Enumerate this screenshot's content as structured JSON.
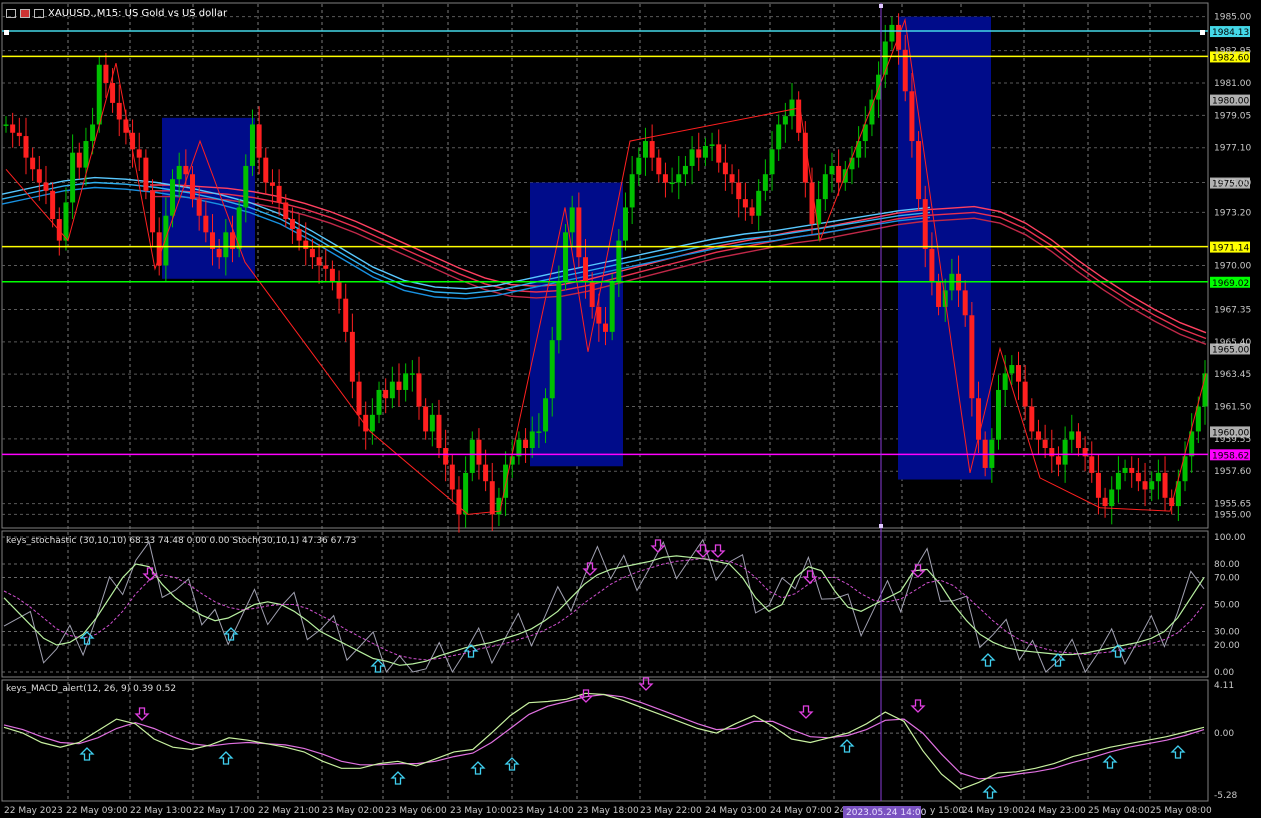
{
  "header": {
    "symbol_title": "XAUUSD.,M15: US Gold vs US dollar"
  },
  "price_axis": {
    "ticks": [
      "1985.00",
      "1982.95",
      "1981.00",
      "1979.05",
      "1977.10",
      "1975.00",
      "1973.20",
      "1970.00",
      "1967.35",
      "1965.40",
      "1963.45",
      "1961.50",
      "1959.55",
      "1957.60",
      "1955.65",
      "1955.00"
    ],
    "tick_values": [
      1985.0,
      1982.95,
      1981.0,
      1979.05,
      1977.1,
      1975.0,
      1973.2,
      1970.0,
      1967.35,
      1965.4,
      1963.45,
      1961.5,
      1959.55,
      1957.6,
      1955.65,
      1955.0
    ],
    "range": [
      1954.3,
      1985.7
    ]
  },
  "price_levels": [
    {
      "label": "1984.13",
      "value": 1984.13,
      "color": "#44d8e8"
    },
    {
      "label": "1982.60",
      "value": 1982.6,
      "color": "#ffff00"
    },
    {
      "label": "1980.00",
      "value": 1980.0,
      "color": "#b0b0b0"
    },
    {
      "label": "1975.00",
      "value": 1975.0,
      "color": "#b0b0b0"
    },
    {
      "label": "1971.14",
      "value": 1971.14,
      "color": "#ffff00"
    },
    {
      "label": "1969.02",
      "value": 1969.02,
      "color": "#00ff00"
    },
    {
      "label": "1965.00",
      "value": 1965.0,
      "color": "#b0b0b0"
    },
    {
      "label": "1960.00",
      "value": 1960.0,
      "color": "#b0b0b0"
    },
    {
      "label": "1958.62",
      "value": 1958.62,
      "color": "#ff00ff"
    }
  ],
  "stochastic": {
    "title": "keys_stochastic (30,10,10) 68.33 74.48 0.00 0.00 Stoch(30,10,1) 47.36 67.73",
    "ticks": [
      "100.00",
      "80.00",
      "70.00",
      "50.00",
      "30.00",
      "20.00",
      "0.00"
    ],
    "tick_values": [
      100,
      80,
      70,
      50,
      30,
      20,
      0
    ]
  },
  "macd": {
    "title": "keys_MACD_alert(12, 26, 9) 0.39 0.52",
    "ticks": [
      "4.11",
      "0.00",
      "-5.28"
    ],
    "tick_values": [
      4.11,
      0,
      -5.28
    ]
  },
  "time_axis": {
    "labels": [
      "22 May 2023",
      "22 May 09:00",
      "22 May 13:00",
      "22 May 17:00",
      "22 May 21:00",
      "23 May 02:00",
      "23 May 06:00",
      "23 May 10:00",
      "23 May 14:00",
      "23 May 18:00",
      "23 May 22:00",
      "24 May 03:00",
      "24 May 07:00",
      "24",
      "y 15:00",
      "24 May 19:00",
      "24 May 23:00",
      "25 May 04:00",
      "25 May 08:00"
    ],
    "cursor_label": "2023.05.24 14:00"
  },
  "chart_data": {
    "type": "candlestick",
    "symbol": "XAUUSD.",
    "timeframe": "M15",
    "bull_color": "#00c000",
    "bear_color": "#ff2020",
    "close_path": [
      1978.5,
      1978.0,
      1977.8,
      1976.5,
      1975.8,
      1975.0,
      1974.5,
      1972.8,
      1971.5,
      1973.8,
      1976.8,
      1975.9,
      1977.5,
      1978.5,
      1982.1,
      1981.0,
      1979.8,
      1978.8,
      1978.0,
      1977.0,
      1976.5,
      1974.5,
      1972.0,
      1970.0,
      1973.0,
      1975.2,
      1976.0,
      1975.5,
      1974.0,
      1973.0,
      1972.0,
      1971.0,
      1970.5,
      1972.0,
      1971.0,
      1973.5,
      1976.0,
      1978.5,
      1976.5,
      1975.0,
      1974.8,
      1973.8,
      1972.8,
      1972.2,
      1971.5,
      1971.0,
      1970.5,
      1970.0,
      1969.8,
      1969.0,
      1968.0,
      1966.0,
      1963.0,
      1961.0,
      1960.0,
      1961.0,
      1962.5,
      1962.0,
      1963.0,
      1962.5,
      1963.5,
      1963.5,
      1961.5,
      1960.0,
      1961.0,
      1959.0,
      1958.0,
      1956.5,
      1955.0,
      1957.5,
      1959.5,
      1958.0,
      1957.0,
      1955.0,
      1956.0,
      1958.0,
      1958.5,
      1959.5,
      1959.0,
      1960.0,
      1960.0,
      1962.0,
      1965.5,
      1969.0,
      1972.0,
      1973.5,
      1970.5,
      1969.0,
      1967.5,
      1966.5,
      1966.0,
      1969.0,
      1971.5,
      1973.5,
      1975.5,
      1976.5,
      1977.5,
      1976.5,
      1975.5,
      1975.0,
      1975.0,
      1975.5,
      1976.0,
      1977.0,
      1976.5,
      1977.2,
      1977.3,
      1976.2,
      1975.5,
      1975.0,
      1974.0,
      1973.5,
      1973.0,
      1974.5,
      1975.5,
      1977.0,
      1978.5,
      1979.0,
      1980.0,
      1978.0,
      1975.0,
      1972.5,
      1974.0,
      1975.5,
      1976.0,
      1975.0,
      1975.8,
      1976.5,
      1977.5,
      1978.5,
      1980.0,
      1981.5,
      1983.5,
      1984.5,
      1983.0,
      1980.5,
      1977.5,
      1974.0,
      1971.0,
      1969.0,
      1967.5,
      1968.5,
      1969.5,
      1968.5,
      1967.0,
      1962.0,
      1959.5,
      1957.8,
      1959.5,
      1962.5,
      1963.5,
      1964.0,
      1963.0,
      1961.5,
      1960.0,
      1959.5,
      1959.0,
      1958.5,
      1958.0,
      1959.5,
      1960.0,
      1959.0,
      1958.5,
      1957.5,
      1956.0,
      1955.5,
      1956.5,
      1957.5,
      1957.8,
      1957.5,
      1957.0,
      1956.5,
      1957.0,
      1957.5,
      1956.0,
      1955.5,
      1957.0,
      1958.5,
      1960.0,
      1961.5,
      1963.5
    ],
    "ema_red_band": [
      1974.5,
      1974.5,
      1974.4,
      1974.3,
      1974.1,
      1973.8,
      1973.4,
      1972.9,
      1972.3,
      1971.6,
      1970.9,
      1970.2,
      1969.5,
      1968.9,
      1968.5,
      1968.4,
      1968.5,
      1968.8,
      1969.2,
      1969.6,
      1970.0,
      1970.4,
      1970.8,
      1971.1,
      1971.4,
      1971.7,
      1971.9,
      1972.2,
      1972.5,
      1972.8,
      1973.0,
      1973.1,
      1973.2,
      1972.9,
      1972.2,
      1971.2,
      1970.0,
      1968.9,
      1967.9,
      1967.0,
      1966.2,
      1965.6
    ],
    "ema_blue_band": [
      1974.0,
      1974.4,
      1974.8,
      1975.0,
      1974.9,
      1974.7,
      1974.4,
      1974.0,
      1973.5,
      1972.8,
      1971.8,
      1970.7,
      1969.6,
      1968.8,
      1968.4,
      1968.3,
      1968.5,
      1968.9,
      1969.3,
      1969.7,
      1970.1,
      1970.5,
      1970.9,
      1971.3,
      1971.6,
      1971.8,
      1972.1,
      1972.4,
      1972.7,
      1973.0,
      1973.2
    ],
    "highlight_boxes": [
      {
        "from": 1978.9,
        "to": 1969.2
      },
      {
        "from": 1975.0,
        "to": 1957.9
      },
      {
        "from": 1985.0,
        "to": 1957.1
      }
    ],
    "stoch_main": [
      55,
      45,
      35,
      25,
      20,
      22,
      28,
      40,
      55,
      70,
      80,
      78,
      65,
      55,
      48,
      42,
      38,
      40,
      45,
      50,
      52,
      50,
      45,
      38,
      30,
      25,
      20,
      15,
      10,
      8,
      5,
      6,
      8,
      12,
      15,
      18,
      20,
      22,
      25,
      28,
      32,
      38,
      45,
      55,
      65,
      72,
      76,
      78,
      80,
      82,
      85,
      86,
      85,
      84,
      82,
      80,
      70,
      55,
      45,
      50,
      70,
      78,
      75,
      60,
      48,
      45,
      50,
      55,
      60,
      75,
      76,
      65,
      50,
      38,
      28,
      22,
      18,
      16,
      15,
      14,
      13,
      13,
      14,
      16,
      18,
      20,
      22,
      25,
      30,
      40,
      55,
      70
    ],
    "stoch_signal": [
      60,
      55,
      48,
      40,
      32,
      27,
      25,
      28,
      35,
      45,
      58,
      68,
      72,
      70,
      65,
      58,
      52,
      48,
      46,
      47,
      49,
      50,
      50,
      47,
      42,
      37,
      31,
      26,
      21,
      16,
      12,
      10,
      9,
      10,
      12,
      14,
      17,
      19,
      21,
      24,
      27,
      31,
      36,
      43,
      51,
      58,
      65,
      70,
      74,
      77,
      80,
      82,
      83,
      84,
      83,
      82,
      78,
      70,
      60,
      55,
      58,
      65,
      70,
      70,
      65,
      58,
      53,
      52,
      54,
      60,
      66,
      68,
      64,
      56,
      47,
      38,
      30,
      24,
      20,
      17,
      15,
      14,
      13,
      14,
      15,
      17,
      19,
      21,
      24,
      29,
      38,
      50
    ],
    "macd_main": [
      0.5,
      0.0,
      -0.8,
      -1.2,
      -0.8,
      0.2,
      1.2,
      0.8,
      -0.5,
      -1.2,
      -1.4,
      -1.0,
      -0.4,
      -0.6,
      -0.9,
      -1.2,
      -1.6,
      -2.4,
      -3.0,
      -3.0,
      -2.6,
      -2.4,
      -2.8,
      -2.2,
      -1.6,
      -1.4,
      0.0,
      1.5,
      2.6,
      2.7,
      2.9,
      3.4,
      3.3,
      2.8,
      2.2,
      1.6,
      1.0,
      0.4,
      0.0,
      0.8,
      1.5,
      0.6,
      -0.5,
      -0.8,
      -0.4,
      0.0,
      0.8,
      1.8,
      1.0,
      -1.5,
      -3.5,
      -4.8,
      -4.2,
      -3.4,
      -3.3,
      -3.0,
      -2.6,
      -2.0,
      -1.6,
      -1.2,
      -0.9,
      -0.6,
      -0.3,
      0.1,
      0.5
    ],
    "macd_signal": [
      0.7,
      0.3,
      -0.3,
      -0.8,
      -0.9,
      -0.4,
      0.4,
      0.9,
      0.4,
      -0.3,
      -0.9,
      -1.1,
      -0.9,
      -0.8,
      -0.9,
      -1.0,
      -1.3,
      -1.8,
      -2.4,
      -2.7,
      -2.7,
      -2.6,
      -2.6,
      -2.4,
      -2.0,
      -1.7,
      -0.8,
      0.4,
      1.6,
      2.3,
      2.7,
      3.1,
      3.3,
      3.1,
      2.6,
      2.0,
      1.4,
      0.8,
      0.3,
      0.4,
      1.0,
      1.0,
      0.3,
      -0.3,
      -0.4,
      -0.2,
      0.3,
      1.1,
      1.2,
      0.0,
      -1.8,
      -3.4,
      -3.9,
      -3.8,
      -3.5,
      -3.3,
      -3.0,
      -2.5,
      -2.1,
      -1.6,
      -1.2,
      -0.9,
      -0.6,
      -0.2,
      0.3
    ]
  }
}
